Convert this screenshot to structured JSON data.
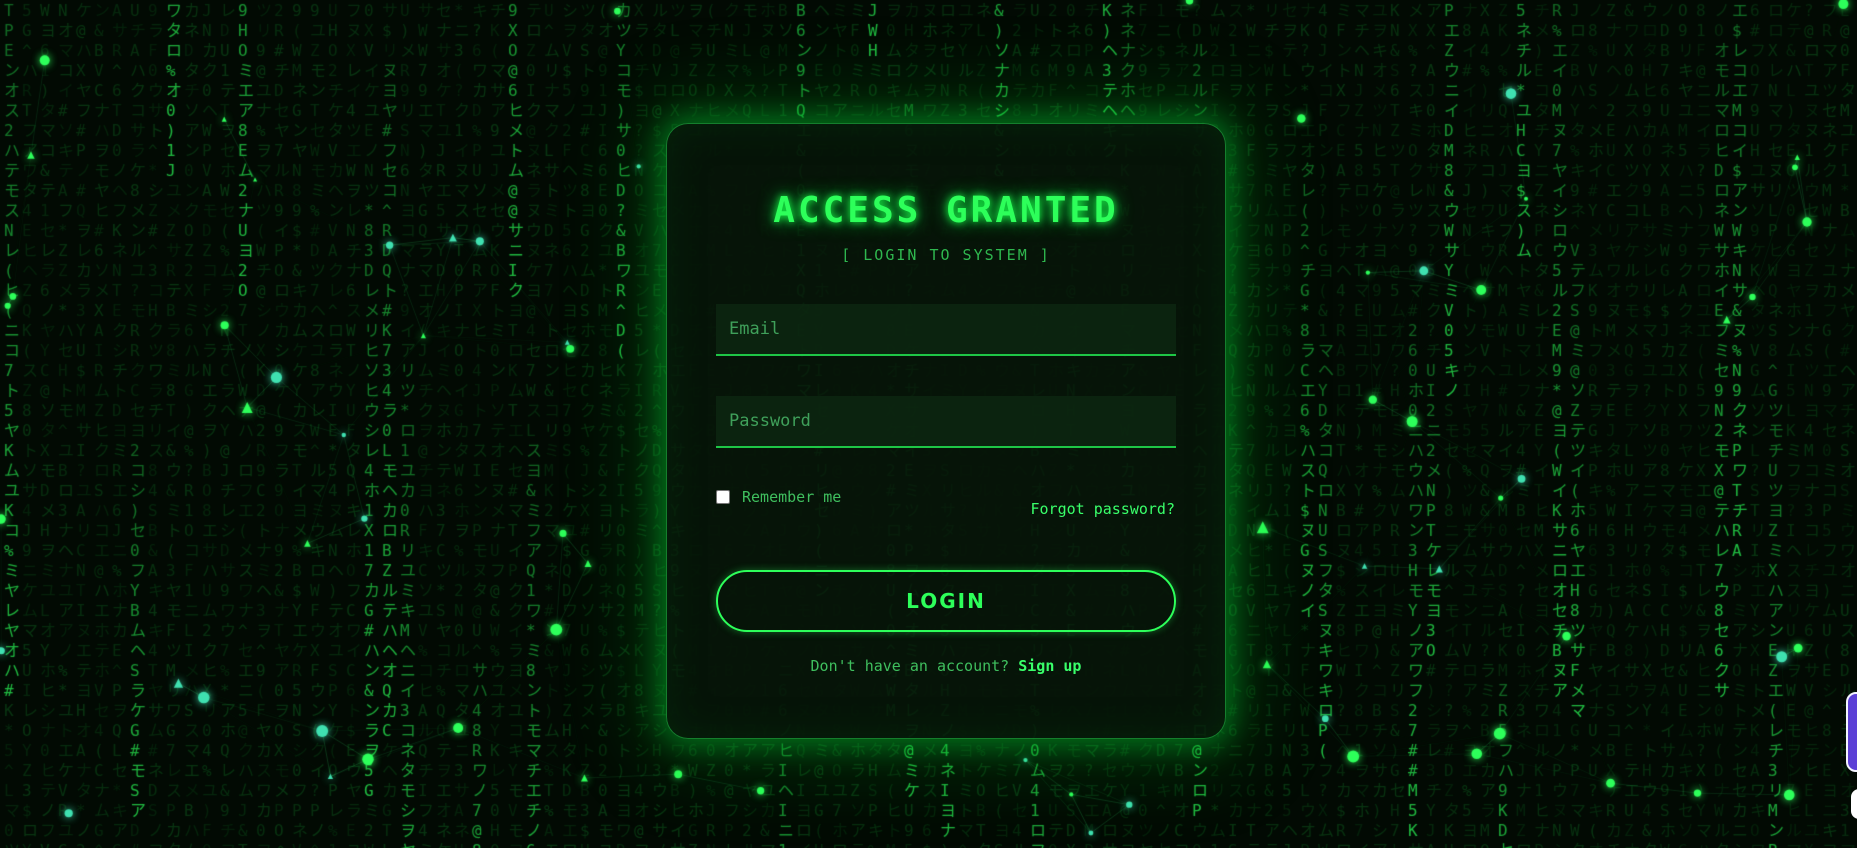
{
  "login": {
    "title": "ACCESS GRANTED",
    "subtitle": "[ LOGIN TO SYSTEM ]",
    "email_placeholder": "Email",
    "password_placeholder": "Password",
    "remember_label": "Remember me",
    "forgot_label": "Forgot password?",
    "login_label": "LOGIN",
    "signup_prompt": "Don't have an account?",
    "signup_label": "Sign up"
  },
  "colors": {
    "accent": "#2dff5a",
    "rain": "#22c544",
    "background": "#020a03",
    "particle_teal": "#3fe0b0"
  },
  "icons": [
    "checkbox-icon"
  ]
}
